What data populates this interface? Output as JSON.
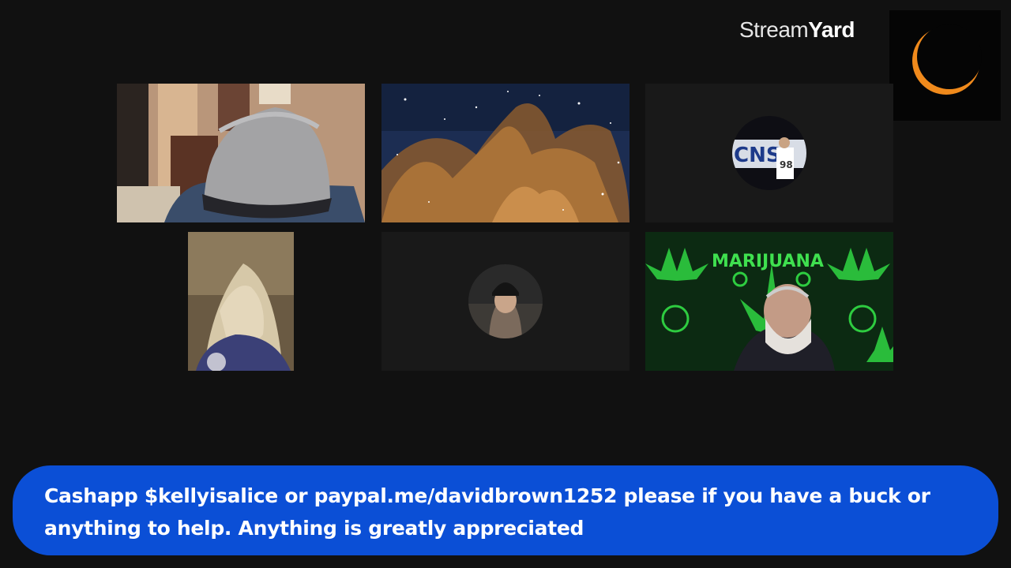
{
  "app": {
    "brand_prefix": "Stream",
    "brand_suffix": "Yard"
  },
  "logo": {
    "icon": "crescent-moon-icon",
    "accent": "#f08a1c"
  },
  "participants": [
    {
      "tile": "participant-tile-hat",
      "content": "camera-feed"
    },
    {
      "tile": "participant-tile-nebula",
      "content": "camera-feed"
    },
    {
      "tile": "participant-tile-avatar-1",
      "content": "avatar"
    },
    {
      "tile": "participant-tile-blonde",
      "content": "camera-feed"
    },
    {
      "tile": "participant-tile-avatar-2",
      "content": "avatar"
    },
    {
      "tile": "participant-tile-marijuana",
      "content": "camera-feed"
    }
  ],
  "background_text": {
    "marijuana": "MARIJUANA",
    "badge": "CNS",
    "jersey": "98"
  },
  "banner": {
    "text": "Cashapp $kellyisalice or paypal.me/davidbrown1252 please if you have a buck or anything to help. Anything is greatly appreciated",
    "color": "#0b4fd6"
  }
}
